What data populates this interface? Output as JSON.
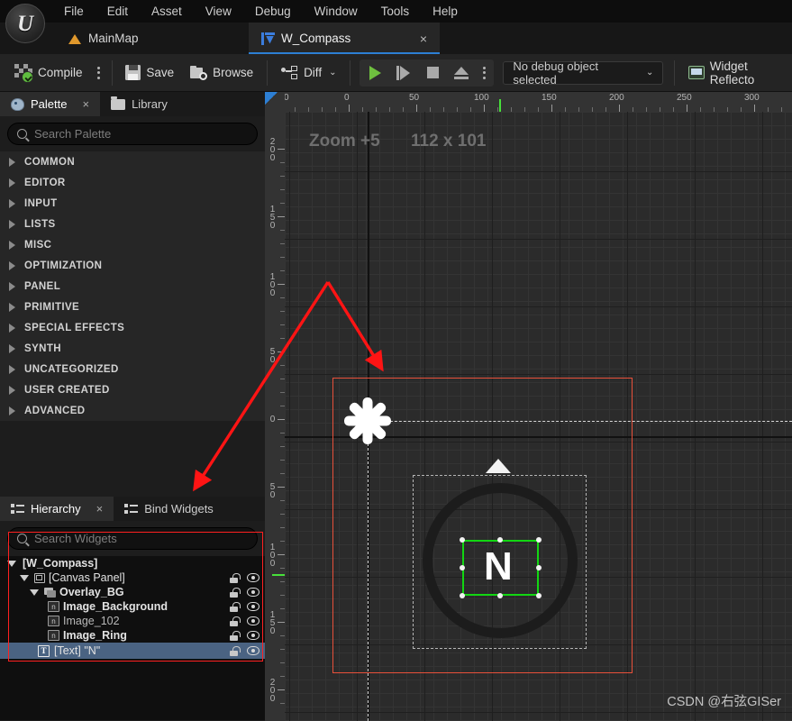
{
  "app": {
    "title": "Unreal Editor",
    "logo_glyph": "U"
  },
  "menu": {
    "items": [
      {
        "label": "File"
      },
      {
        "label": "Edit"
      },
      {
        "label": "Asset"
      },
      {
        "label": "View"
      },
      {
        "label": "Debug"
      },
      {
        "label": "Window"
      },
      {
        "label": "Tools"
      },
      {
        "label": "Help"
      }
    ]
  },
  "tabs": [
    {
      "label": "MainMap",
      "icon": "level-icon",
      "active": false
    },
    {
      "label": "W_Compass",
      "icon": "umg-widget-icon",
      "active": true,
      "close": "×"
    }
  ],
  "toolbar": {
    "compile_label": "Compile",
    "save_label": "Save",
    "browse_label": "Browse",
    "diff_label": "Diff",
    "diff_chevron": "⌄",
    "debug_object_label": "No debug object selected",
    "debug_object_chevron": "⌄",
    "widget_reflector_label": "Widget Reflecto"
  },
  "palette_panel": {
    "tabs": [
      {
        "label": "Palette",
        "icon": "palette-icon",
        "active": true,
        "close": "×"
      },
      {
        "label": "Library",
        "icon": "folder-icon",
        "active": false
      }
    ],
    "search": {
      "value": "",
      "placeholder": "Search Palette"
    },
    "categories": [
      {
        "label": "COMMON"
      },
      {
        "label": "EDITOR"
      },
      {
        "label": "INPUT"
      },
      {
        "label": "LISTS"
      },
      {
        "label": "MISC"
      },
      {
        "label": "OPTIMIZATION"
      },
      {
        "label": "PANEL"
      },
      {
        "label": "PRIMITIVE"
      },
      {
        "label": "SPECIAL EFFECTS"
      },
      {
        "label": "SYNTH"
      },
      {
        "label": "UNCATEGORIZED"
      },
      {
        "label": "USER CREATED"
      },
      {
        "label": "ADVANCED"
      }
    ]
  },
  "hierarchy_panel": {
    "tabs": [
      {
        "label": "Hierarchy",
        "icon": "list-icon",
        "active": true,
        "close": "×"
      },
      {
        "label": "Bind Widgets",
        "icon": "list-icon",
        "active": false
      }
    ],
    "search": {
      "value": "",
      "placeholder": "Search Widgets"
    },
    "rows": [
      {
        "label": "[W_Compass]",
        "indent": 0,
        "icon": "none",
        "expander": "down",
        "selected": false,
        "controls": false
      },
      {
        "label": "[Canvas Panel]",
        "indent": 1,
        "icon": "canvas-icon",
        "expander": "down",
        "selected": false,
        "controls": true
      },
      {
        "label": "Overlay_BG",
        "indent": 2,
        "icon": "overlay-icon",
        "expander": "down",
        "selected": false,
        "controls": true
      },
      {
        "label": "Image_Background",
        "indent": 3,
        "icon": "image-icon",
        "expander": "none",
        "selected": false,
        "controls": true
      },
      {
        "label": "Image_102",
        "indent": 3,
        "icon": "image-icon",
        "expander": "none",
        "selected": false,
        "controls": true
      },
      {
        "label": "Image_Ring",
        "indent": 3,
        "icon": "image-icon",
        "expander": "none",
        "selected": false,
        "controls": true
      },
      {
        "label": "[Text] \"N\"",
        "indent": 3,
        "icon": "text-icon",
        "expander": "none",
        "selected": true,
        "controls": true
      }
    ]
  },
  "designer": {
    "zoom_label": "Zoom +5",
    "dimension_label": "112 x 101",
    "selected_text_glyph": "N",
    "h_ruler_labels": [
      "0",
      "0",
      "50",
      "100",
      "150",
      "200",
      "250",
      "300"
    ],
    "v_ruler_labels": [
      "200",
      "150",
      "100",
      "50",
      "0",
      "50",
      "100",
      "150",
      "200"
    ]
  },
  "watermark": {
    "text": "CSDN @右弦GISer"
  },
  "colors": {
    "accent_blue": "#2d7fd4",
    "compile_green": "#5fbd3f",
    "selection_green": "#12d612",
    "annotation_red": "#ff2020",
    "widget_outline_red": "#e8503a",
    "ruler_cursor_green": "#47e03a",
    "panel_bg": "#1d1d1d",
    "canvas_bg": "#2b2b2b"
  }
}
